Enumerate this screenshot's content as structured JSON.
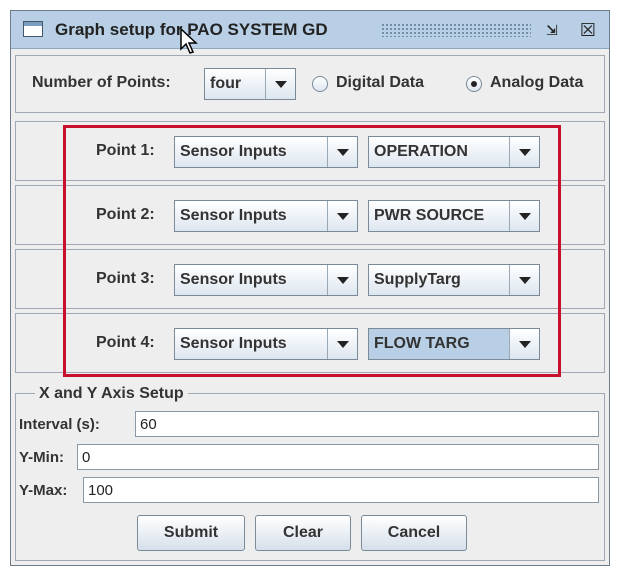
{
  "window": {
    "title": "Graph setup for PAO SYSTEM GD",
    "restore_glyph": "⇲",
    "close_glyph": "☒"
  },
  "top_row": {
    "points_label": "Number of Points:",
    "points_value": "four",
    "digital_label": "Digital Data",
    "analog_label": "Analog Data",
    "selected_mode": "Analog Data"
  },
  "points": [
    {
      "label": "Point 1:",
      "source": "Sensor Inputs",
      "signal": "OPERATION"
    },
    {
      "label": "Point 2:",
      "source": "Sensor Inputs",
      "signal": "PWR SOURCE"
    },
    {
      "label": "Point 3:",
      "source": "Sensor Inputs",
      "signal": "SupplyTarg"
    },
    {
      "label": "Point 4:",
      "source": "Sensor Inputs",
      "signal": "FLOW TARG"
    }
  ],
  "axis_setup": {
    "title": "X and Y Axis Setup",
    "interval_label": "Interval (s):",
    "interval_value": "60",
    "ymin_label": "Y-Min:",
    "ymin_value": "0",
    "ymax_label": "Y-Max:",
    "ymax_value": "100"
  },
  "buttons": {
    "submit": "Submit",
    "clear": "Clear",
    "cancel": "Cancel"
  },
  "colors": {
    "titlebar": "#b8cfe5",
    "highlight_border": "#c8102e",
    "panel": "#eeeeee"
  }
}
